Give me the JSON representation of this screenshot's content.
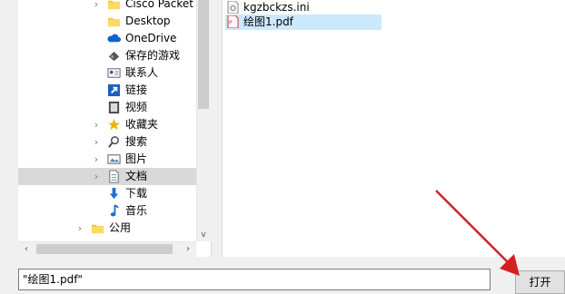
{
  "nav": {
    "items": [
      {
        "label": "Cisco Packet",
        "icon": "folder-icon",
        "chevron": "›",
        "selected": false
      },
      {
        "label": "Desktop",
        "icon": "folder-icon",
        "chevron": "",
        "selected": false
      },
      {
        "label": "OneDrive",
        "icon": "cloud-icon",
        "chevron": "",
        "selected": false
      },
      {
        "label": "保存的游戏",
        "icon": "saved-games-icon",
        "chevron": "",
        "selected": false
      },
      {
        "label": "联系人",
        "icon": "contacts-icon",
        "chevron": "",
        "selected": false
      },
      {
        "label": "链接",
        "icon": "link-icon",
        "chevron": "",
        "selected": false
      },
      {
        "label": "视频",
        "icon": "video-icon",
        "chevron": "",
        "selected": false
      },
      {
        "label": "收藏夹",
        "icon": "star-icon",
        "chevron": "›",
        "selected": false
      },
      {
        "label": "搜索",
        "icon": "search-icon",
        "chevron": "›",
        "selected": false
      },
      {
        "label": "图片",
        "icon": "pictures-icon",
        "chevron": "›",
        "selected": false
      },
      {
        "label": "文档",
        "icon": "documents-icon",
        "chevron": "›",
        "selected": true
      },
      {
        "label": "下载",
        "icon": "download-icon",
        "chevron": "",
        "selected": false
      },
      {
        "label": "音乐",
        "icon": "music-icon",
        "chevron": "",
        "selected": false
      },
      {
        "label": "公用",
        "icon": "folder-icon",
        "chevron": "›",
        "selected": false
      }
    ],
    "scroll_left": "‹",
    "scroll_right": "›",
    "scroll_down": "v"
  },
  "files": {
    "items": [
      {
        "label": "kgzbckzs.ini",
        "icon": "ini-file-icon",
        "selected": false
      },
      {
        "label": "绘图1.pdf",
        "icon": "pdf-file-icon",
        "selected": true
      }
    ]
  },
  "filename": {
    "value": "\"绘图1.pdf\""
  },
  "open_button": {
    "label": "打开"
  },
  "colors": {
    "selection": "#cce8ff",
    "nav_selected": "#d9d9d9",
    "arrow": "#d42020"
  }
}
